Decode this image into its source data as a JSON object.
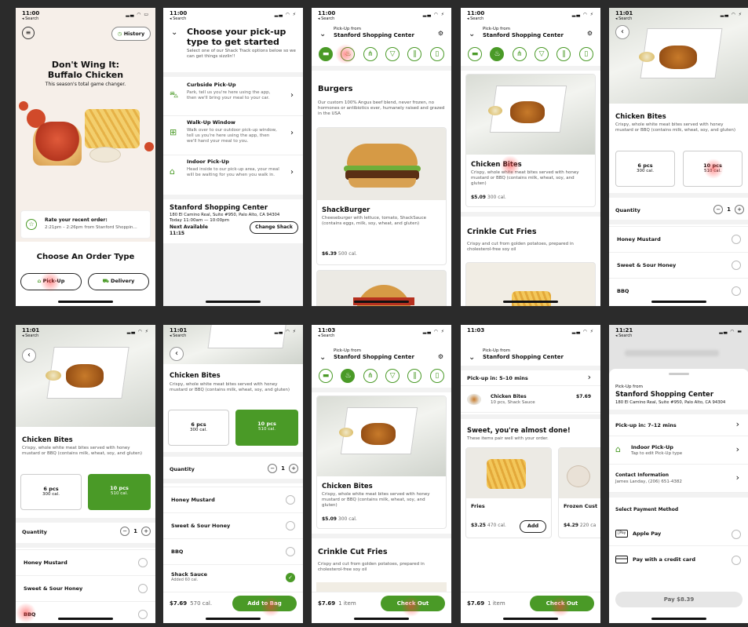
{
  "p1": {
    "time": "11:00",
    "back": "◂ Search",
    "history": "History",
    "hero_title": "Don't Wing It:\nBuffalo Chicken",
    "hero_sub": "This season's total game changer.",
    "rate_title": "Rate your recent order:",
    "rate_sub": "2:21pm – 2:26pm from Stanford Shoppin...",
    "choose": "Choose An Order Type",
    "pickup": "Pick-Up",
    "delivery": "Delivery"
  },
  "p2": {
    "time": "11:00",
    "back": "◂ Search",
    "title": "Choose your pick-up type to get started",
    "sub": "Select one of our Shack Track options below so we can get things sizzlin'!",
    "options": [
      {
        "title": "Curbside Pick-Up",
        "desc": "Park, tell us you're here using the app, then we'll bring your meal to your car."
      },
      {
        "title": "Walk-Up Window",
        "desc": "Walk over to our outdoor pick-up window, tell us you're here using the app, then we'll hand your meal to you."
      },
      {
        "title": "Indoor Pick-Up",
        "desc": "Head inside to our pick-up area, your meal will be waiting for you when you walk in."
      }
    ],
    "store": "Stanford Shopping Center",
    "addr": "180 El Camino Real, Suite #950, Palo Alto, CA 94304",
    "hours": "Today 11:00am — 10:00pm",
    "next": "Next Available",
    "next_time": "11:15",
    "change": "Change Shack"
  },
  "p3": {
    "time": "11:00",
    "back": "◂ Search",
    "pickup_from": "Pick-Up from",
    "store": "Stanford Shopping Center",
    "section": "Burgers",
    "section_desc": "Our custom 100% Angus beef blend, never frozen, no hormones or antibiotics ever, humanely raised and grazed in the USA",
    "item": "ShackBurger",
    "item_desc": "Cheeseburger with lettuce, tomato, ShackSauce (contains eggs, milk, soy, wheat, and gluten)",
    "price": "$6.39",
    "cal": "500 cal."
  },
  "p4": {
    "time": "11:00",
    "back": "◂ Search",
    "pickup_from": "Pick-Up from",
    "store": "Stanford Shopping Center",
    "item": "Chicken Bites",
    "item_desc": "Crispy, whole white meat bites served with honey mustard or BBQ (contains milk, wheat, soy, and gluten)",
    "price": "$5.09",
    "cal": "300 cal.",
    "section": "Crinkle Cut Fries",
    "section_desc": "Crispy and cut from golden potatoes, prepared in cholesterol-free soy oil"
  },
  "p5": {
    "time": "11:01",
    "back": "◂ Search",
    "item": "Chicken Bites",
    "item_desc": "Crispy, whole white meat bites served with honey mustard or BBQ (contains milk, wheat, soy, and gluten)",
    "size1": "6 pcs",
    "size1_cal": "300 cal.",
    "size2": "10 pcs",
    "size2_cal": "510 cal.",
    "qty_label": "Quantity",
    "qty": "1",
    "opts": [
      "Honey Mustard",
      "Sweet & Sour Honey",
      "BBQ"
    ]
  },
  "p6": {
    "time": "11:01",
    "back": "◂ Search",
    "item": "Chicken Bites",
    "item_desc": "Crispy, whole white meat bites served with honey mustard or BBQ (contains milk, wheat, soy, and gluten)",
    "size1": "6 pcs",
    "size1_cal": "300 cal.",
    "size2": "10 pcs",
    "size2_cal": "510 cal.",
    "qty_label": "Quantity",
    "qty": "1",
    "opts": [
      "Honey Mustard",
      "Sweet & Sour Honey",
      "BBQ"
    ]
  },
  "p7": {
    "time": "11:01",
    "back": "◂ Search",
    "item": "Chicken Bites",
    "item_desc": "Crispy, whole white meat bites served with honey mustard or BBQ (contains milk, wheat, soy, and gluten)",
    "size1": "6 pcs",
    "size1_cal": "300 cal.",
    "size2": "10 pcs",
    "size2_cal": "510 cal.",
    "qty_label": "Quantity",
    "qty": "1",
    "opts": [
      "Honey Mustard",
      "Sweet & Sour Honey",
      "BBQ"
    ],
    "sauce": "Shack Sauce",
    "sauce_sub": "Added 60 cal.",
    "price": "$7.69",
    "cal": "570 cal.",
    "add": "Add to Bag"
  },
  "p8": {
    "time": "11:03",
    "back": "◂ Search",
    "pickup_from": "Pick-Up from",
    "store": "Stanford Shopping Center",
    "item": "Chicken Bites",
    "item_desc": "Crispy, whole white meat bites served with honey mustard or BBQ (contains milk, wheat, soy, and gluten)",
    "price": "$5.09",
    "cal": "300 cal.",
    "section": "Crinkle Cut Fries",
    "section_desc": "Crispy and cut from golden potatoes, prepared in cholesterol-free soy oil",
    "total": "$7.69",
    "items": "1 item",
    "checkout": "Check Out"
  },
  "p9": {
    "time": "11:03",
    "pickup_from": "Pick-Up from",
    "store": "Stanford Shopping Center",
    "pickup_in": "Pick-up in: 5–10 mins",
    "bag_item": "Chicken Bites",
    "bag_sub": "10 pcs, Shack Sauce",
    "bag_price": "$7.69",
    "almost": "Sweet, you're almost done!",
    "almost_sub": "These items pair well with your order.",
    "up1": "Fries",
    "up1_price": "$3.25",
    "up1_cal": "470 cal.",
    "up2": "Frozen Cust",
    "up2_price": "$4.29",
    "up2_cal": "220 ca",
    "add": "Add",
    "total": "$7.69",
    "items": "1 item",
    "checkout": "Check Out"
  },
  "p10": {
    "time": "11:21",
    "back": "◂ Search",
    "pickup_from": "Pick-Up from",
    "store": "Stanford Shopping Center",
    "addr": "180 El Camino Real, Suite #950, Palo Alto, CA 94304",
    "pickup_in": "Pick-up in: 7–12 mins",
    "type": "Indoor Pick-Up",
    "type_sub": "Tap to edit Pick-Up type",
    "contact": "Contact Information",
    "contact_sub": "James Landay, (206) 651-4382",
    "pay_title": "Select Payment Method",
    "apple": "Apple Pay",
    "apple_badge": "Pay",
    "card": "Pay with a credit card",
    "pay": "Pay $8.39"
  }
}
